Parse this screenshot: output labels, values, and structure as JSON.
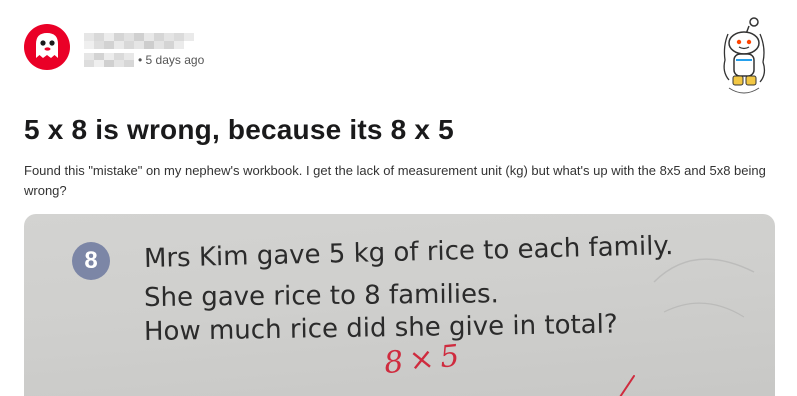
{
  "header": {
    "time_ago": "• 5 days ago",
    "icons": {
      "avatar": "ghost-avatar-icon",
      "mascot": "reddit-mascot-icon"
    },
    "colors": {
      "avatar_bg": "#ea0027",
      "pixel_light": "#e2e2e2",
      "pixel_mid": "#cfcfcf"
    }
  },
  "post": {
    "title": "5 x 8 is wrong, because its 8 x 5",
    "body": "Found this \"mistake\" on my nephew's workbook. I get the lack of measurement unit (kg) but what's up with the 8x5 and 5x8 being wrong?"
  },
  "image": {
    "question_number": "8",
    "lines": [
      "Mrs Kim gave 5 kg of rice to each family.",
      "She gave rice to 8 families.",
      "How much rice did she give in total?"
    ],
    "handwritten": "8×5",
    "colors": {
      "badge": "#7c86a6",
      "ink": "#cf2b3e"
    }
  }
}
